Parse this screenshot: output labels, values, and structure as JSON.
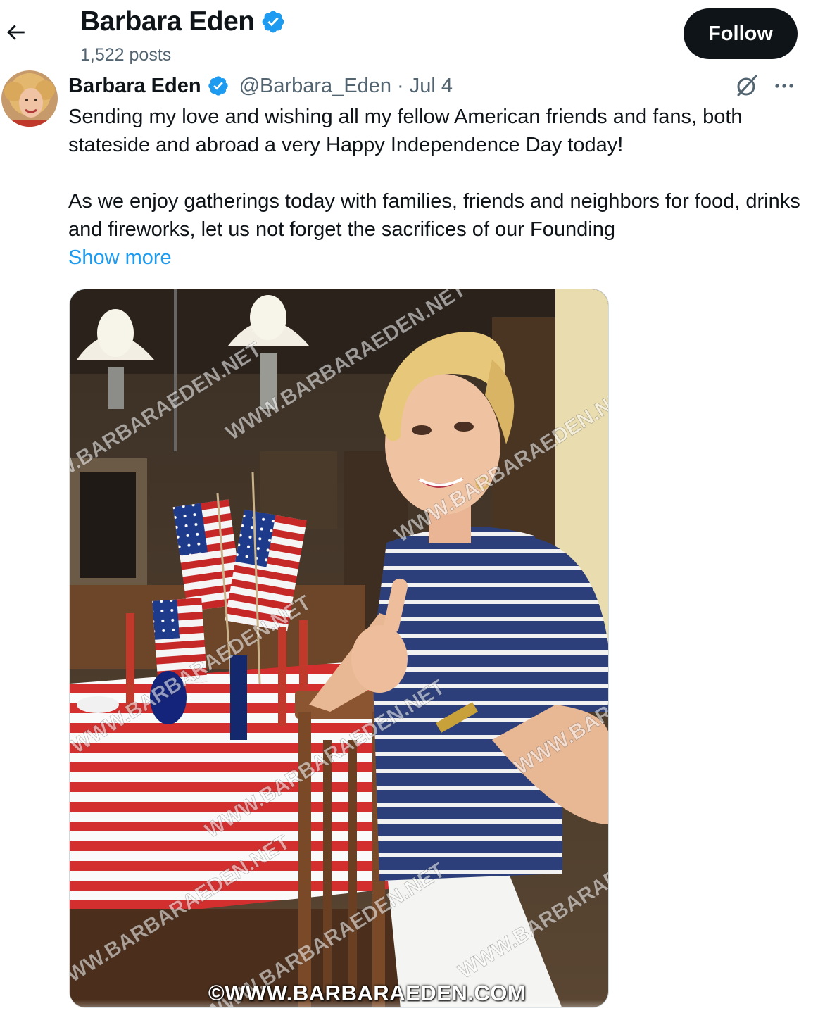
{
  "header": {
    "title": "Barbara Eden",
    "posts_count": "1,522 posts",
    "follow_label": "Follow"
  },
  "post": {
    "author_name": "Barbara Eden",
    "handle": "@Barbara_Eden",
    "separator": "·",
    "date": "Jul 4",
    "text_paragraph_1": "Sending my love and wishing all my fellow American friends and fans, both stateside and abroad a very Happy Independence Day today!",
    "text_paragraph_2": "As we enjoy gatherings today with families, friends and neighbors for food, drinks and fireworks, let us not forget the sacrifices of our Founding",
    "show_more_label": "Show more"
  },
  "media": {
    "watermark_text": "WWW.BARBARAEDEN.NET",
    "copyright_text": "©WWW.BARBARAEDEN.COM"
  },
  "icons": {
    "back": "arrow-left-icon",
    "verified": "verified-badge-icon",
    "grok": "grok-icon",
    "more": "more-horizontal-icon"
  },
  "colors": {
    "text_primary": "#0f1419",
    "text_secondary": "#536471",
    "link": "#1d9bf0",
    "verified": "#1d9bf0",
    "button_bg": "#0f1419"
  }
}
